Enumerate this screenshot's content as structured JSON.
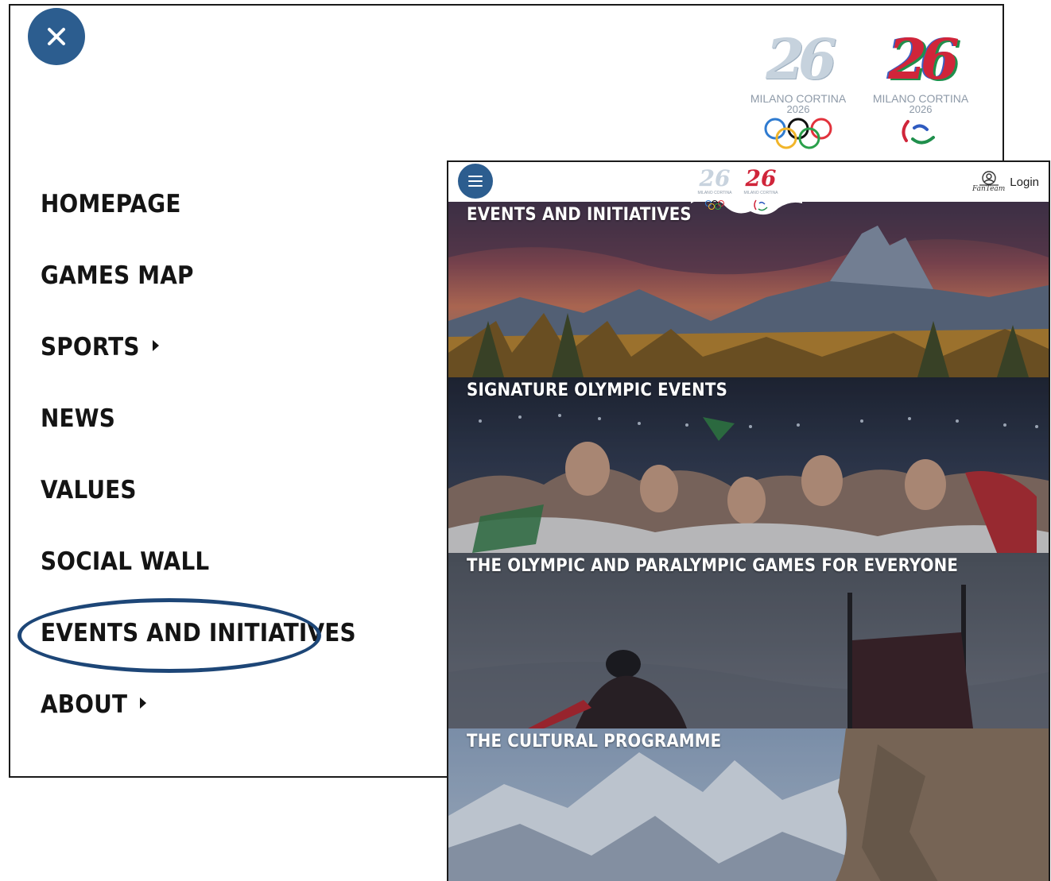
{
  "menu": {
    "items": [
      {
        "label": "HOMEPAGE",
        "has_submenu": false
      },
      {
        "label": "GAMES MAP",
        "has_submenu": false
      },
      {
        "label": "SPORTS",
        "has_submenu": true
      },
      {
        "label": "NEWS",
        "has_submenu": false
      },
      {
        "label": "VALUES",
        "has_submenu": false
      },
      {
        "label": "SOCIAL WALL",
        "has_submenu": false
      },
      {
        "label": "EVENTS AND INITIATIVES",
        "has_submenu": false,
        "highlighted": true
      },
      {
        "label": "ABOUT",
        "has_submenu": true
      }
    ],
    "close_icon": "close-icon"
  },
  "logos": {
    "olympic": {
      "mark": "26",
      "caption": "MILANO CORTINA",
      "year": "2026",
      "symbol": "olympic-rings-icon"
    },
    "paralympic": {
      "mark": "26",
      "caption": "MILANO CORTINA",
      "year": "2026",
      "symbol": "agitos-icon"
    }
  },
  "screen": {
    "header": {
      "menu_icon": "hamburger-icon",
      "login_label": "Login",
      "login_brand": "FanTeam",
      "login_icon": "user-icon"
    },
    "tiles": [
      {
        "title": "EVENTS AND INITIATIVES",
        "image": "mountain-sunset"
      },
      {
        "title": "SIGNATURE OLYMPIC EVENTS",
        "image": "athletes-celebrating"
      },
      {
        "title": "THE OLYMPIC AND PARALYMPIC GAMES FOR EVERYONE",
        "image": "para-skier"
      },
      {
        "title": "THE CULTURAL PROGRAMME",
        "image": "snowy-mountains"
      }
    ]
  },
  "colors": {
    "accent_blue": "#2c5d8f",
    "oval_blue": "#1d4677",
    "menu_text": "#141414"
  }
}
